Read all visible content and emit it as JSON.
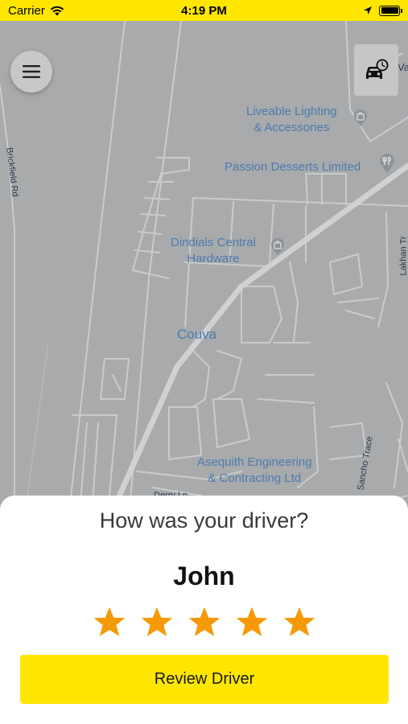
{
  "status_bar": {
    "carrier": "Carrier",
    "time": "4:19 PM"
  },
  "map": {
    "labels": {
      "liveable": "Liveable Lighting\n& Accessories",
      "passion": "Passion Desserts Limited",
      "dindials": "Dindials Central\nHardware",
      "couva": "Couva",
      "asequith": "Asequith Engineering\n& Contracting Ltd",
      "brickfield": "Brickfield Rd",
      "lakhan": "Lakhan Tr",
      "sancho": "Sancho Trace",
      "derry": "Derry Ln",
      "edge": "Va"
    }
  },
  "rating": {
    "question": "How was your driver?",
    "driver_name": "John",
    "stars_selected": 5,
    "stars_total": 5,
    "review_button": "Review Driver"
  },
  "colors": {
    "accent": "#ffe600",
    "star": "#f59a06",
    "map_background": "#a8aaac",
    "road": "#cfd1d3",
    "label": "#4d7bb0"
  }
}
